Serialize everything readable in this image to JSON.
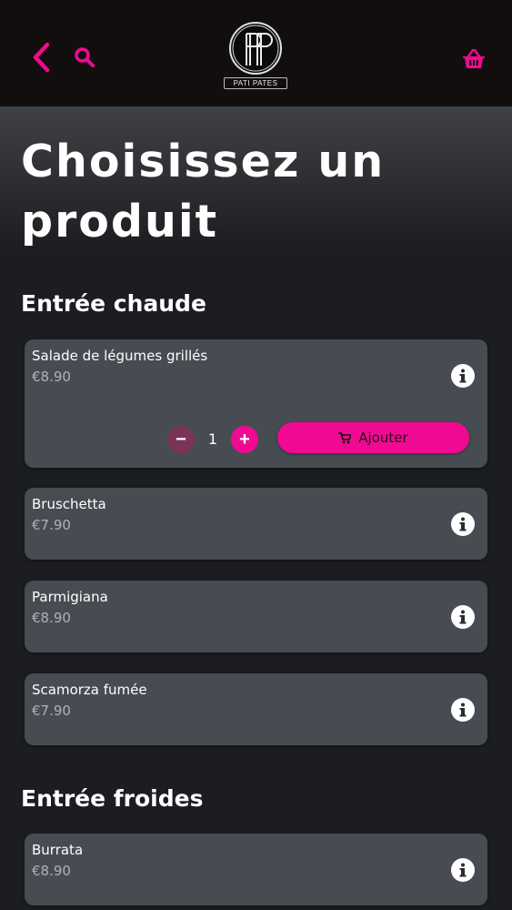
{
  "colors": {
    "accent": "#f00a91",
    "header_bg": "#120e0e",
    "card_bg": "#474c52",
    "price_text": "#aeb2b7"
  },
  "header": {
    "back_icon": "chevron-left-icon",
    "search_icon": "search-icon",
    "basket_icon": "basket-icon",
    "logo_initials": "PP",
    "logo_text": "PATI PATES"
  },
  "page": {
    "title": "Choisissez un produit"
  },
  "sections": [
    {
      "title": "Entrée chaude",
      "items": [
        {
          "name": "Salade de légumes grillés",
          "price": "€8.90",
          "quantity": "1",
          "add_label": "Ajouter"
        },
        {
          "name": "Bruschetta",
          "price": "€7.90"
        },
        {
          "name": "Parmigiana",
          "price": "€8.90"
        },
        {
          "name": "Scamorza fumée",
          "price": "€7.90"
        }
      ]
    },
    {
      "title": "Entrée froides",
      "items": [
        {
          "name": "Burrata",
          "price": "€8.90"
        }
      ]
    }
  ]
}
